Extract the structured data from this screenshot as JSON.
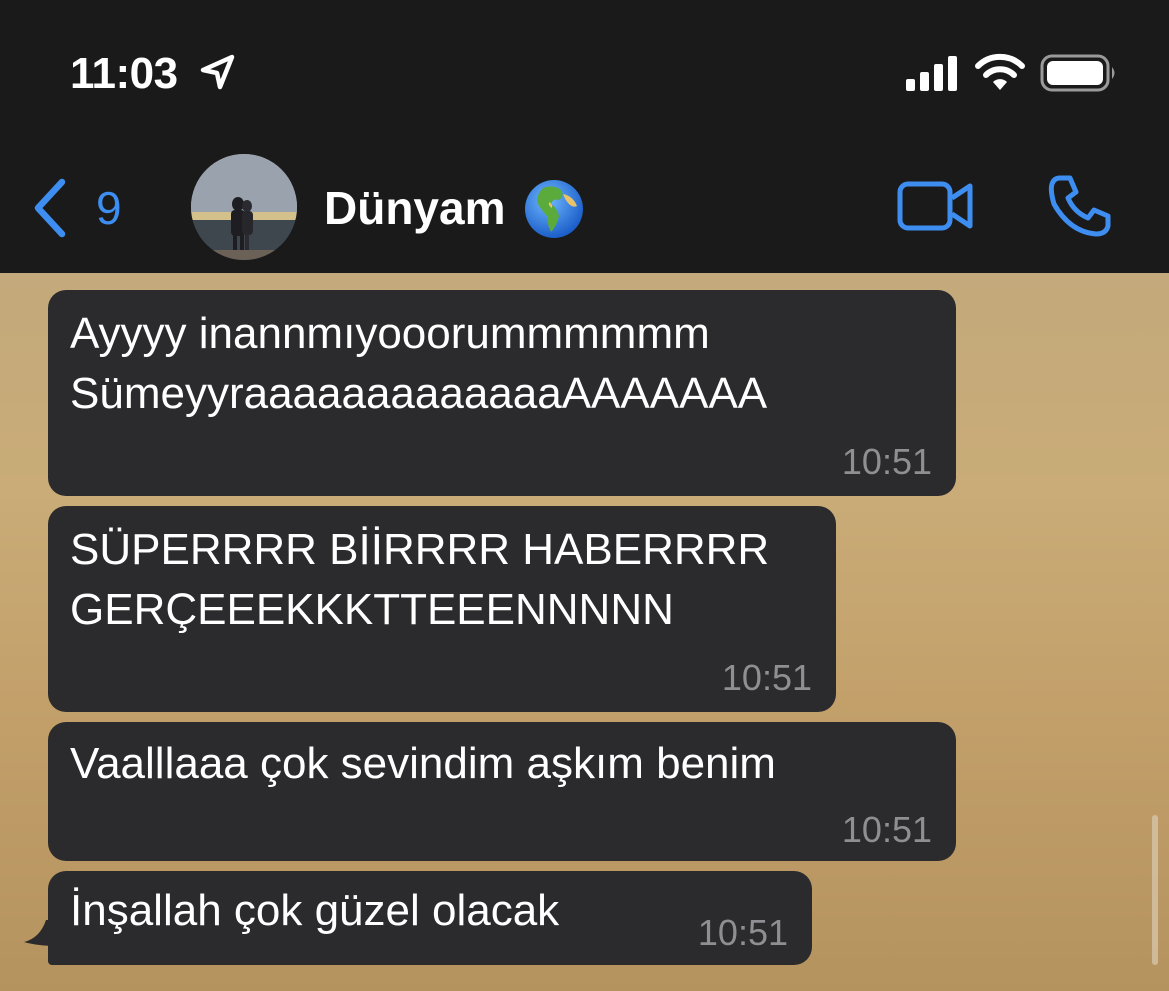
{
  "status_bar": {
    "time": "11:03"
  },
  "header": {
    "back_count": "9",
    "contact_name": "Dünyam"
  },
  "messages": [
    {
      "text": "Ayyyy inannmıyooorummmmmm\nSümeyyraaaaaaaaaaaaaAAAAAAA",
      "time": "10:51"
    },
    {
      "text": "SÜPERRRR BİİRRRR HABERRRR\nGERÇEEEKKKTTEEENNNNN",
      "time": "10:51"
    },
    {
      "text": "Vaalllaaa çok sevindim aşkım benim",
      "time": "10:51"
    },
    {
      "text": "İnşallah çok güzel olacak",
      "time": "10:51"
    }
  ],
  "colors": {
    "accent": "#3d8ef0",
    "bubble": "#2b2b2d",
    "bar": "#1a1a1a",
    "timestamp": "#8e8e93"
  },
  "icons": [
    "location-arrow-icon",
    "signal-icon",
    "wifi-icon",
    "battery-icon",
    "back-chevron-icon",
    "globe-emoji-icon",
    "video-call-icon",
    "phone-call-icon"
  ]
}
